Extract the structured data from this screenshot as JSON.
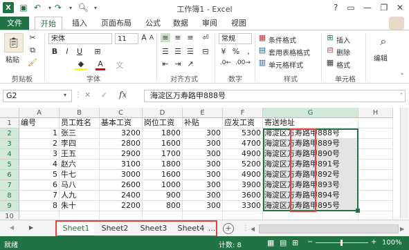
{
  "window": {
    "title": "工作簿1 - Excel",
    "help": "?",
    "minimize": "—",
    "restore": "❐",
    "close": "✕"
  },
  "tabs": [
    "文件",
    "开始",
    "插入",
    "页面布局",
    "公式",
    "数据",
    "审阅",
    "视图"
  ],
  "ribbon": {
    "paste": "粘贴",
    "clipboard": "剪贴板",
    "font_name": "宋体",
    "font_size": "11",
    "font_group": "字体",
    "align_group": "对齐方式",
    "number_format": "常规",
    "number_group": "数字",
    "cond_format": "条件格式",
    "table_format": "套用表格格式",
    "cell_style": "单元格样式",
    "style_group": "样式",
    "insert": "插入",
    "delete": "删除",
    "format": "格式",
    "cells_group": "单元格",
    "edit": "编辑",
    "bold": "B",
    "italic": "I",
    "underline": "U",
    "font_color": "A"
  },
  "formula_bar": {
    "name_box": "G2",
    "fx": "fx",
    "cancel": "✕",
    "enter": "✓",
    "formula": "海淀区万寿路甲888号"
  },
  "columns": [
    "A",
    "B",
    "C",
    "D",
    "E",
    "F",
    "G",
    "H"
  ],
  "rows": [
    {
      "n": "1",
      "A": "编号",
      "B": "员工姓名",
      "C": "基本工资",
      "D": "岗位工资",
      "E": "补贴",
      "F": "应发工资",
      "G": "寄送地址"
    },
    {
      "n": "2",
      "A": "1",
      "B": "张三",
      "C": "3200",
      "D": "1800",
      "E": "300",
      "F": "5300",
      "G": "海淀区万寿路甲888号"
    },
    {
      "n": "3",
      "A": "2",
      "B": "李四",
      "C": "2800",
      "D": "1600",
      "E": "300",
      "F": "4700",
      "G": "海淀区万寿路甲889号"
    },
    {
      "n": "4",
      "A": "3",
      "B": "王五",
      "C": "2900",
      "D": "1700",
      "E": "300",
      "F": "4900",
      "G": "海淀区万寿路甲890号"
    },
    {
      "n": "5",
      "A": "4",
      "B": "赵六",
      "C": "3100",
      "D": "1800",
      "E": "300",
      "F": "5200",
      "G": "海淀区万寿路甲891号"
    },
    {
      "n": "6",
      "A": "5",
      "B": "牛七",
      "C": "3000",
      "D": "1600",
      "E": "300",
      "F": "4900",
      "G": "海淀区万寿路甲892号"
    },
    {
      "n": "7",
      "A": "6",
      "B": "马八",
      "C": "2600",
      "D": "1000",
      "E": "300",
      "F": "3900",
      "G": "海淀区万寿路甲893号"
    },
    {
      "n": "8",
      "A": "7",
      "B": "人九",
      "C": "2400",
      "D": "900",
      "E": "300",
      "F": "3600",
      "G": "海淀区万寿路甲894号"
    },
    {
      "n": "9",
      "A": "8",
      "B": "朱十",
      "C": "2200",
      "D": "800",
      "E": "300",
      "F": "3300",
      "G": "海淀区万寿路甲895号"
    },
    {
      "n": "10"
    },
    {
      "n": "11"
    }
  ],
  "sheets": [
    "Sheet1",
    "Sheet2",
    "Sheet3",
    "Sheet4"
  ],
  "sheet_more": "...",
  "status": {
    "ready": "就绪",
    "count": "计数: 8",
    "zoom": "100%"
  },
  "colors": {
    "excel_green": "#217346",
    "highlight_red": "#e8423f",
    "selection_gray": "#a6a6a6"
  }
}
